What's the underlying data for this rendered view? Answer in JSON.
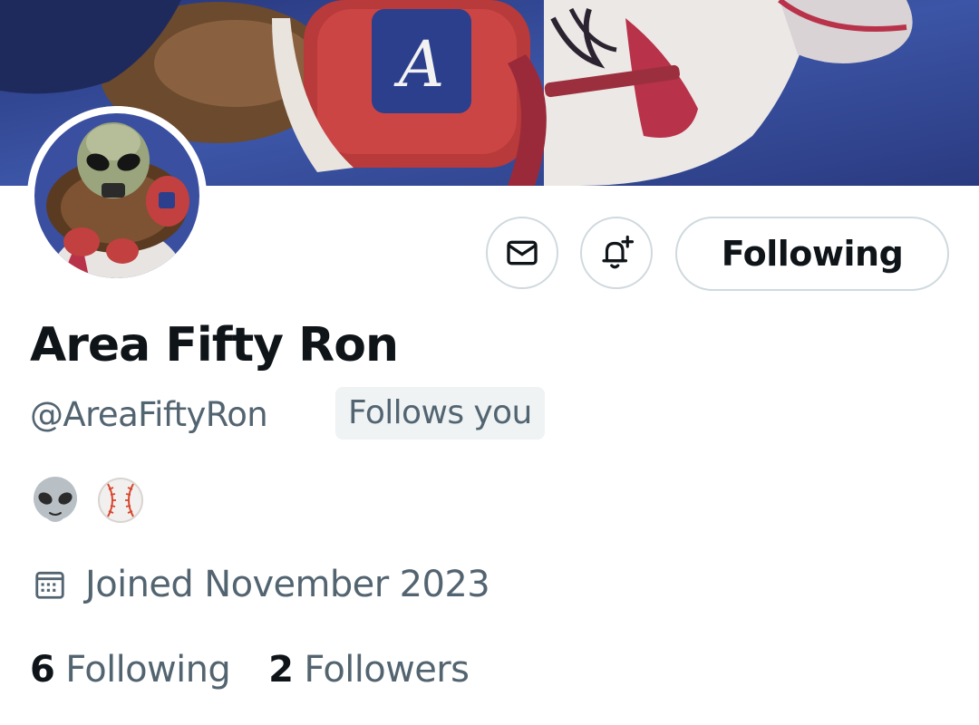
{
  "profile": {
    "display_name": "Area Fifty Ron",
    "handle": "@AreaFiftyRon",
    "follows_you_badge": "Follows you",
    "bio_emojis": [
      "alien",
      "baseball"
    ],
    "joined": "Joined November 2023"
  },
  "actions": {
    "message_icon": "envelope-icon",
    "notify_icon": "bell-plus-icon",
    "following_label": "Following"
  },
  "stats": {
    "following_count": "6",
    "following_label": "Following",
    "followers_count": "2",
    "followers_label": "Followers"
  },
  "colors": {
    "text_primary": "#0f1419",
    "text_secondary": "#536471",
    "border": "#cfd9de",
    "badge_bg": "#eff3f4",
    "banner_blue": "#3e56a8"
  }
}
